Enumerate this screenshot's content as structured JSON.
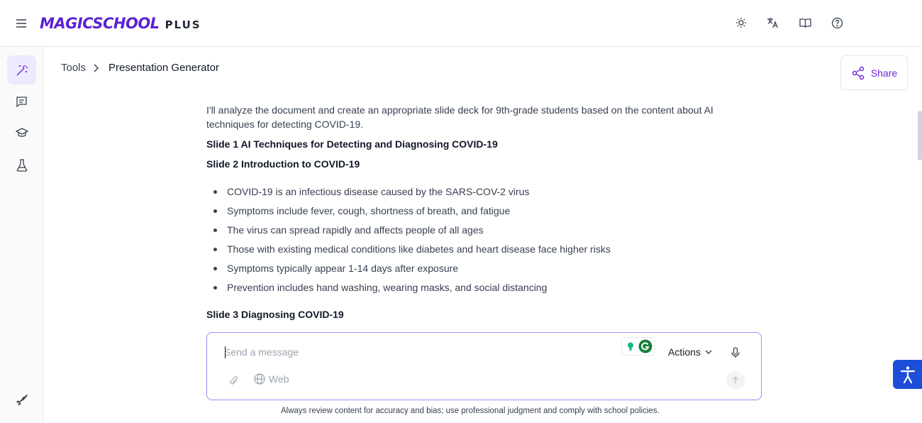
{
  "header": {
    "logo_main": "MAGICSCHOOL",
    "logo_plus": "PLUS",
    "icons": [
      "menu-icon",
      "sun-icon",
      "translate-icon",
      "book-icon",
      "help-icon"
    ]
  },
  "sidebar": {
    "items": [
      {
        "icon": "magic-wand-icon",
        "active": true
      },
      {
        "icon": "chat-icon",
        "active": false
      },
      {
        "icon": "graduation-cap-icon",
        "active": false
      },
      {
        "icon": "flask-icon",
        "active": false
      },
      {
        "icon": "rocket-icon",
        "active": false
      }
    ]
  },
  "breadcrumb": {
    "parent": "Tools",
    "current": "Presentation Generator"
  },
  "share": {
    "label": "Share"
  },
  "content": {
    "intro": "I'll analyze the document and create an appropriate slide deck for 9th-grade students based on the content about AI techniques for detecting COVID-19.",
    "slide1": "Slide 1 AI Techniques for Detecting and Diagnosing COVID-19",
    "slide2": "Slide 2 Introduction to COVID-19",
    "slide2_bullets": [
      "COVID-19 is an infectious disease caused by the SARS-COV-2 virus",
      "Symptoms include fever, cough, shortness of breath, and fatigue",
      "The virus can spread rapidly and affects people of all ages",
      "Those with existing medical conditions like diabetes and heart disease face higher risks",
      "Symptoms typically appear 1-14 days after exposure",
      "Prevention includes hand washing, wearing masks, and social distancing"
    ],
    "slide3": "Slide 3 Diagnosing COVID-19"
  },
  "composer": {
    "placeholder": "Send a message",
    "actions_label": "Actions",
    "web_label": "Web"
  },
  "disclaimer": "Always review content for accuracy and bias; use professional judgment and comply with school policies.",
  "colors": {
    "brand": "#5b21d6",
    "accent_border": "#a78bfa",
    "accessibility": "#1d4ed8"
  }
}
